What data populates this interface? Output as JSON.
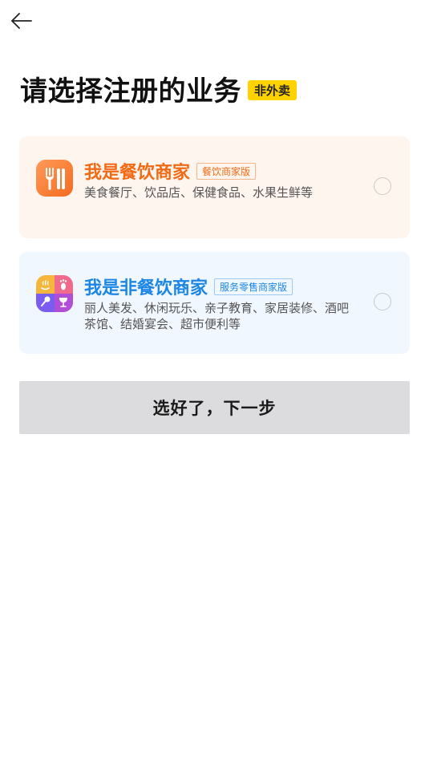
{
  "header": {
    "back_icon": "arrow-left-icon"
  },
  "page": {
    "title": "请选择注册的业务",
    "badge": "非外卖"
  },
  "options": [
    {
      "title": "我是餐饮商家",
      "tag": "餐饮商家版",
      "description": "美食餐厅、饮品店、保健食品、水果生鲜等",
      "icon": "fork-knife-icon",
      "accent_color": "#f26a14",
      "background_color": "#fff5ef",
      "selected": false
    },
    {
      "title": "我是非餐饮商家",
      "tag": "服务零售商家版",
      "description": "丽人美发、休闲玩乐、亲子教育、家居装修、酒吧茶馆、结婚宴会、超市便利等",
      "icon": "multi-service-icon",
      "accent_color": "#1b86e6",
      "background_color": "#f1f7fe",
      "selected": false
    }
  ],
  "actions": {
    "next_label": "选好了，下一步"
  }
}
